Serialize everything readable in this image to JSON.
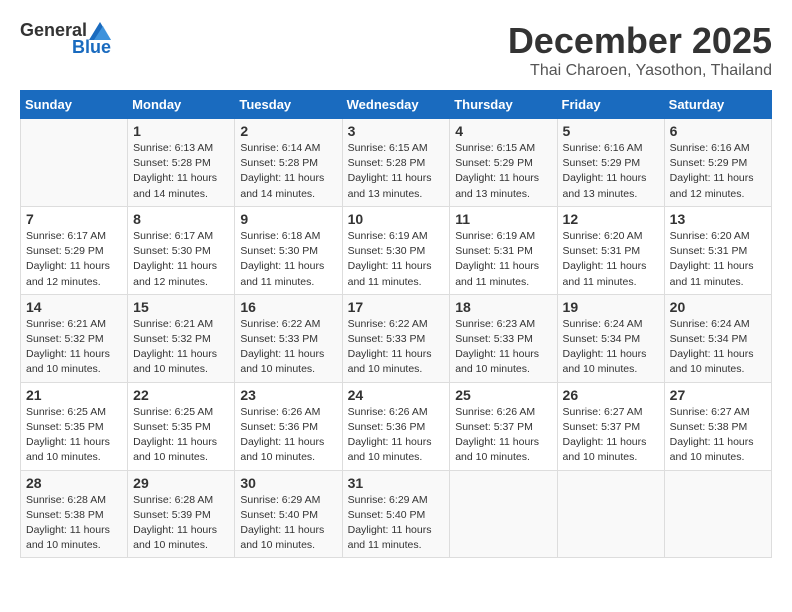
{
  "header": {
    "logo_general": "General",
    "logo_blue": "Blue",
    "month": "December 2025",
    "location": "Thai Charoen, Yasothon, Thailand"
  },
  "weekdays": [
    "Sunday",
    "Monday",
    "Tuesday",
    "Wednesday",
    "Thursday",
    "Friday",
    "Saturday"
  ],
  "weeks": [
    [
      {
        "day": "",
        "sunrise": "",
        "sunset": "",
        "daylight": ""
      },
      {
        "day": "1",
        "sunrise": "Sunrise: 6:13 AM",
        "sunset": "Sunset: 5:28 PM",
        "daylight": "Daylight: 11 hours and 14 minutes."
      },
      {
        "day": "2",
        "sunrise": "Sunrise: 6:14 AM",
        "sunset": "Sunset: 5:28 PM",
        "daylight": "Daylight: 11 hours and 14 minutes."
      },
      {
        "day": "3",
        "sunrise": "Sunrise: 6:15 AM",
        "sunset": "Sunset: 5:28 PM",
        "daylight": "Daylight: 11 hours and 13 minutes."
      },
      {
        "day": "4",
        "sunrise": "Sunrise: 6:15 AM",
        "sunset": "Sunset: 5:29 PM",
        "daylight": "Daylight: 11 hours and 13 minutes."
      },
      {
        "day": "5",
        "sunrise": "Sunrise: 6:16 AM",
        "sunset": "Sunset: 5:29 PM",
        "daylight": "Daylight: 11 hours and 13 minutes."
      },
      {
        "day": "6",
        "sunrise": "Sunrise: 6:16 AM",
        "sunset": "Sunset: 5:29 PM",
        "daylight": "Daylight: 11 hours and 12 minutes."
      }
    ],
    [
      {
        "day": "7",
        "sunrise": "Sunrise: 6:17 AM",
        "sunset": "Sunset: 5:29 PM",
        "daylight": "Daylight: 11 hours and 12 minutes."
      },
      {
        "day": "8",
        "sunrise": "Sunrise: 6:17 AM",
        "sunset": "Sunset: 5:30 PM",
        "daylight": "Daylight: 11 hours and 12 minutes."
      },
      {
        "day": "9",
        "sunrise": "Sunrise: 6:18 AM",
        "sunset": "Sunset: 5:30 PM",
        "daylight": "Daylight: 11 hours and 11 minutes."
      },
      {
        "day": "10",
        "sunrise": "Sunrise: 6:19 AM",
        "sunset": "Sunset: 5:30 PM",
        "daylight": "Daylight: 11 hours and 11 minutes."
      },
      {
        "day": "11",
        "sunrise": "Sunrise: 6:19 AM",
        "sunset": "Sunset: 5:31 PM",
        "daylight": "Daylight: 11 hours and 11 minutes."
      },
      {
        "day": "12",
        "sunrise": "Sunrise: 6:20 AM",
        "sunset": "Sunset: 5:31 PM",
        "daylight": "Daylight: 11 hours and 11 minutes."
      },
      {
        "day": "13",
        "sunrise": "Sunrise: 6:20 AM",
        "sunset": "Sunset: 5:31 PM",
        "daylight": "Daylight: 11 hours and 11 minutes."
      }
    ],
    [
      {
        "day": "14",
        "sunrise": "Sunrise: 6:21 AM",
        "sunset": "Sunset: 5:32 PM",
        "daylight": "Daylight: 11 hours and 10 minutes."
      },
      {
        "day": "15",
        "sunrise": "Sunrise: 6:21 AM",
        "sunset": "Sunset: 5:32 PM",
        "daylight": "Daylight: 11 hours and 10 minutes."
      },
      {
        "day": "16",
        "sunrise": "Sunrise: 6:22 AM",
        "sunset": "Sunset: 5:33 PM",
        "daylight": "Daylight: 11 hours and 10 minutes."
      },
      {
        "day": "17",
        "sunrise": "Sunrise: 6:22 AM",
        "sunset": "Sunset: 5:33 PM",
        "daylight": "Daylight: 11 hours and 10 minutes."
      },
      {
        "day": "18",
        "sunrise": "Sunrise: 6:23 AM",
        "sunset": "Sunset: 5:33 PM",
        "daylight": "Daylight: 11 hours and 10 minutes."
      },
      {
        "day": "19",
        "sunrise": "Sunrise: 6:24 AM",
        "sunset": "Sunset: 5:34 PM",
        "daylight": "Daylight: 11 hours and 10 minutes."
      },
      {
        "day": "20",
        "sunrise": "Sunrise: 6:24 AM",
        "sunset": "Sunset: 5:34 PM",
        "daylight": "Daylight: 11 hours and 10 minutes."
      }
    ],
    [
      {
        "day": "21",
        "sunrise": "Sunrise: 6:25 AM",
        "sunset": "Sunset: 5:35 PM",
        "daylight": "Daylight: 11 hours and 10 minutes."
      },
      {
        "day": "22",
        "sunrise": "Sunrise: 6:25 AM",
        "sunset": "Sunset: 5:35 PM",
        "daylight": "Daylight: 11 hours and 10 minutes."
      },
      {
        "day": "23",
        "sunrise": "Sunrise: 6:26 AM",
        "sunset": "Sunset: 5:36 PM",
        "daylight": "Daylight: 11 hours and 10 minutes."
      },
      {
        "day": "24",
        "sunrise": "Sunrise: 6:26 AM",
        "sunset": "Sunset: 5:36 PM",
        "daylight": "Daylight: 11 hours and 10 minutes."
      },
      {
        "day": "25",
        "sunrise": "Sunrise: 6:26 AM",
        "sunset": "Sunset: 5:37 PM",
        "daylight": "Daylight: 11 hours and 10 minutes."
      },
      {
        "day": "26",
        "sunrise": "Sunrise: 6:27 AM",
        "sunset": "Sunset: 5:37 PM",
        "daylight": "Daylight: 11 hours and 10 minutes."
      },
      {
        "day": "27",
        "sunrise": "Sunrise: 6:27 AM",
        "sunset": "Sunset: 5:38 PM",
        "daylight": "Daylight: 11 hours and 10 minutes."
      }
    ],
    [
      {
        "day": "28",
        "sunrise": "Sunrise: 6:28 AM",
        "sunset": "Sunset: 5:38 PM",
        "daylight": "Daylight: 11 hours and 10 minutes."
      },
      {
        "day": "29",
        "sunrise": "Sunrise: 6:28 AM",
        "sunset": "Sunset: 5:39 PM",
        "daylight": "Daylight: 11 hours and 10 minutes."
      },
      {
        "day": "30",
        "sunrise": "Sunrise: 6:29 AM",
        "sunset": "Sunset: 5:40 PM",
        "daylight": "Daylight: 11 hours and 10 minutes."
      },
      {
        "day": "31",
        "sunrise": "Sunrise: 6:29 AM",
        "sunset": "Sunset: 5:40 PM",
        "daylight": "Daylight: 11 hours and 11 minutes."
      },
      {
        "day": "",
        "sunrise": "",
        "sunset": "",
        "daylight": ""
      },
      {
        "day": "",
        "sunrise": "",
        "sunset": "",
        "daylight": ""
      },
      {
        "day": "",
        "sunrise": "",
        "sunset": "",
        "daylight": ""
      }
    ]
  ]
}
